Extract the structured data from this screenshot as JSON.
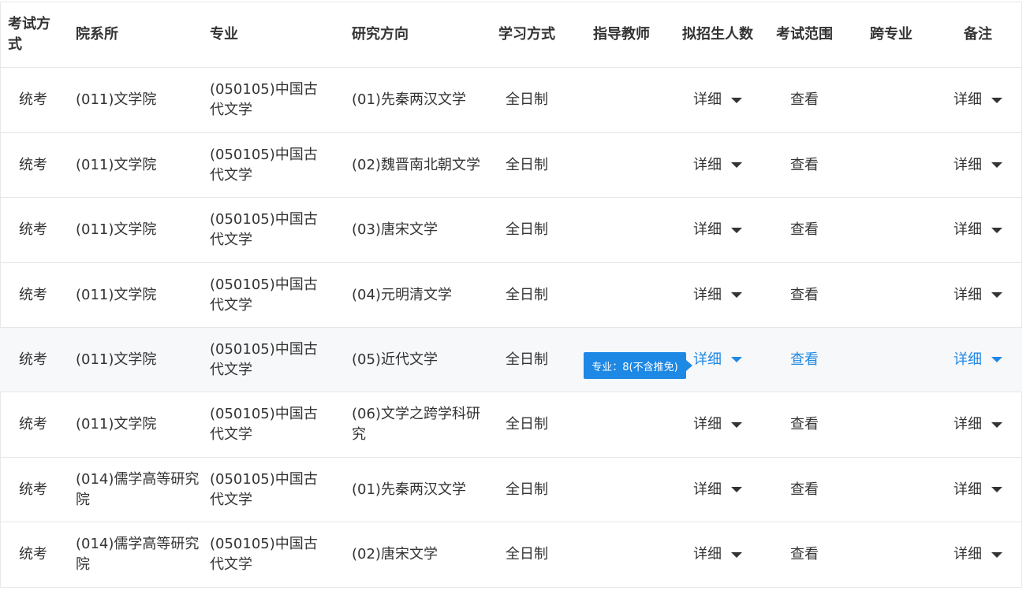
{
  "headers": {
    "exam_mode": "考试方式",
    "department": "院系所",
    "major": "专业",
    "research_direction": "研究方向",
    "study_mode": "学习方式",
    "advisor": "指导教师",
    "enrollment": "拟招生人数",
    "exam_scope": "考试范围",
    "cross_major": "跨专业",
    "remarks": "备注"
  },
  "rows": [
    {
      "exam_mode": "统考",
      "department": "(011)文学院",
      "major": "(050105)中国古代文学",
      "direction": "(01)先秦两汉文学",
      "study_mode": "全日制",
      "advisor": "",
      "enrollment": "详细",
      "exam_scope": "查看",
      "cross_major": "",
      "remarks": "详细"
    },
    {
      "exam_mode": "统考",
      "department": "(011)文学院",
      "major": "(050105)中国古代文学",
      "direction": "(02)魏晋南北朝文学",
      "study_mode": "全日制",
      "advisor": "",
      "enrollment": "详细",
      "exam_scope": "查看",
      "cross_major": "",
      "remarks": "详细"
    },
    {
      "exam_mode": "统考",
      "department": "(011)文学院",
      "major": "(050105)中国古代文学",
      "direction": "(03)唐宋文学",
      "study_mode": "全日制",
      "advisor": "",
      "enrollment": "详细",
      "exam_scope": "查看",
      "cross_major": "",
      "remarks": "详细"
    },
    {
      "exam_mode": "统考",
      "department": "(011)文学院",
      "major": "(050105)中国古代文学",
      "direction": "(04)元明清文学",
      "study_mode": "全日制",
      "advisor": "",
      "enrollment": "详细",
      "exam_scope": "查看",
      "cross_major": "",
      "remarks": "详细"
    },
    {
      "exam_mode": "统考",
      "department": "(011)文学院",
      "major": "(050105)中国古代文学",
      "direction": "(05)近代文学",
      "study_mode": "全日制",
      "advisor": "",
      "enrollment": "详细",
      "exam_scope": "查看",
      "cross_major": "",
      "remarks": "详细"
    },
    {
      "exam_mode": "统考",
      "department": "(011)文学院",
      "major": "(050105)中国古代文学",
      "direction": "(06)文学之跨学科研究",
      "study_mode": "全日制",
      "advisor": "",
      "enrollment": "详细",
      "exam_scope": "查看",
      "cross_major": "",
      "remarks": "详细"
    },
    {
      "exam_mode": "统考",
      "department": "(014)儒学高等研究院",
      "major": "(050105)中国古代文学",
      "direction": "(01)先秦两汉文学",
      "study_mode": "全日制",
      "advisor": "",
      "enrollment": "详细",
      "exam_scope": "查看",
      "cross_major": "",
      "remarks": "详细"
    },
    {
      "exam_mode": "统考",
      "department": "(014)儒学高等研究院",
      "major": "(050105)中国古代文学",
      "direction": "(02)唐宋文学",
      "study_mode": "全日制",
      "advisor": "",
      "enrollment": "详细",
      "exam_scope": "查看",
      "cross_major": "",
      "remarks": "详细"
    }
  ],
  "hovered_row_index": 4,
  "tooltip": {
    "text": "专业：8(不含推免)"
  },
  "colors": {
    "accent": "#1e88e5",
    "row_hover_bg": "#f7f8fa",
    "border": "#e6e6e6",
    "text": "#333333"
  },
  "icons": {
    "dropdown": "caret-down-icon"
  }
}
